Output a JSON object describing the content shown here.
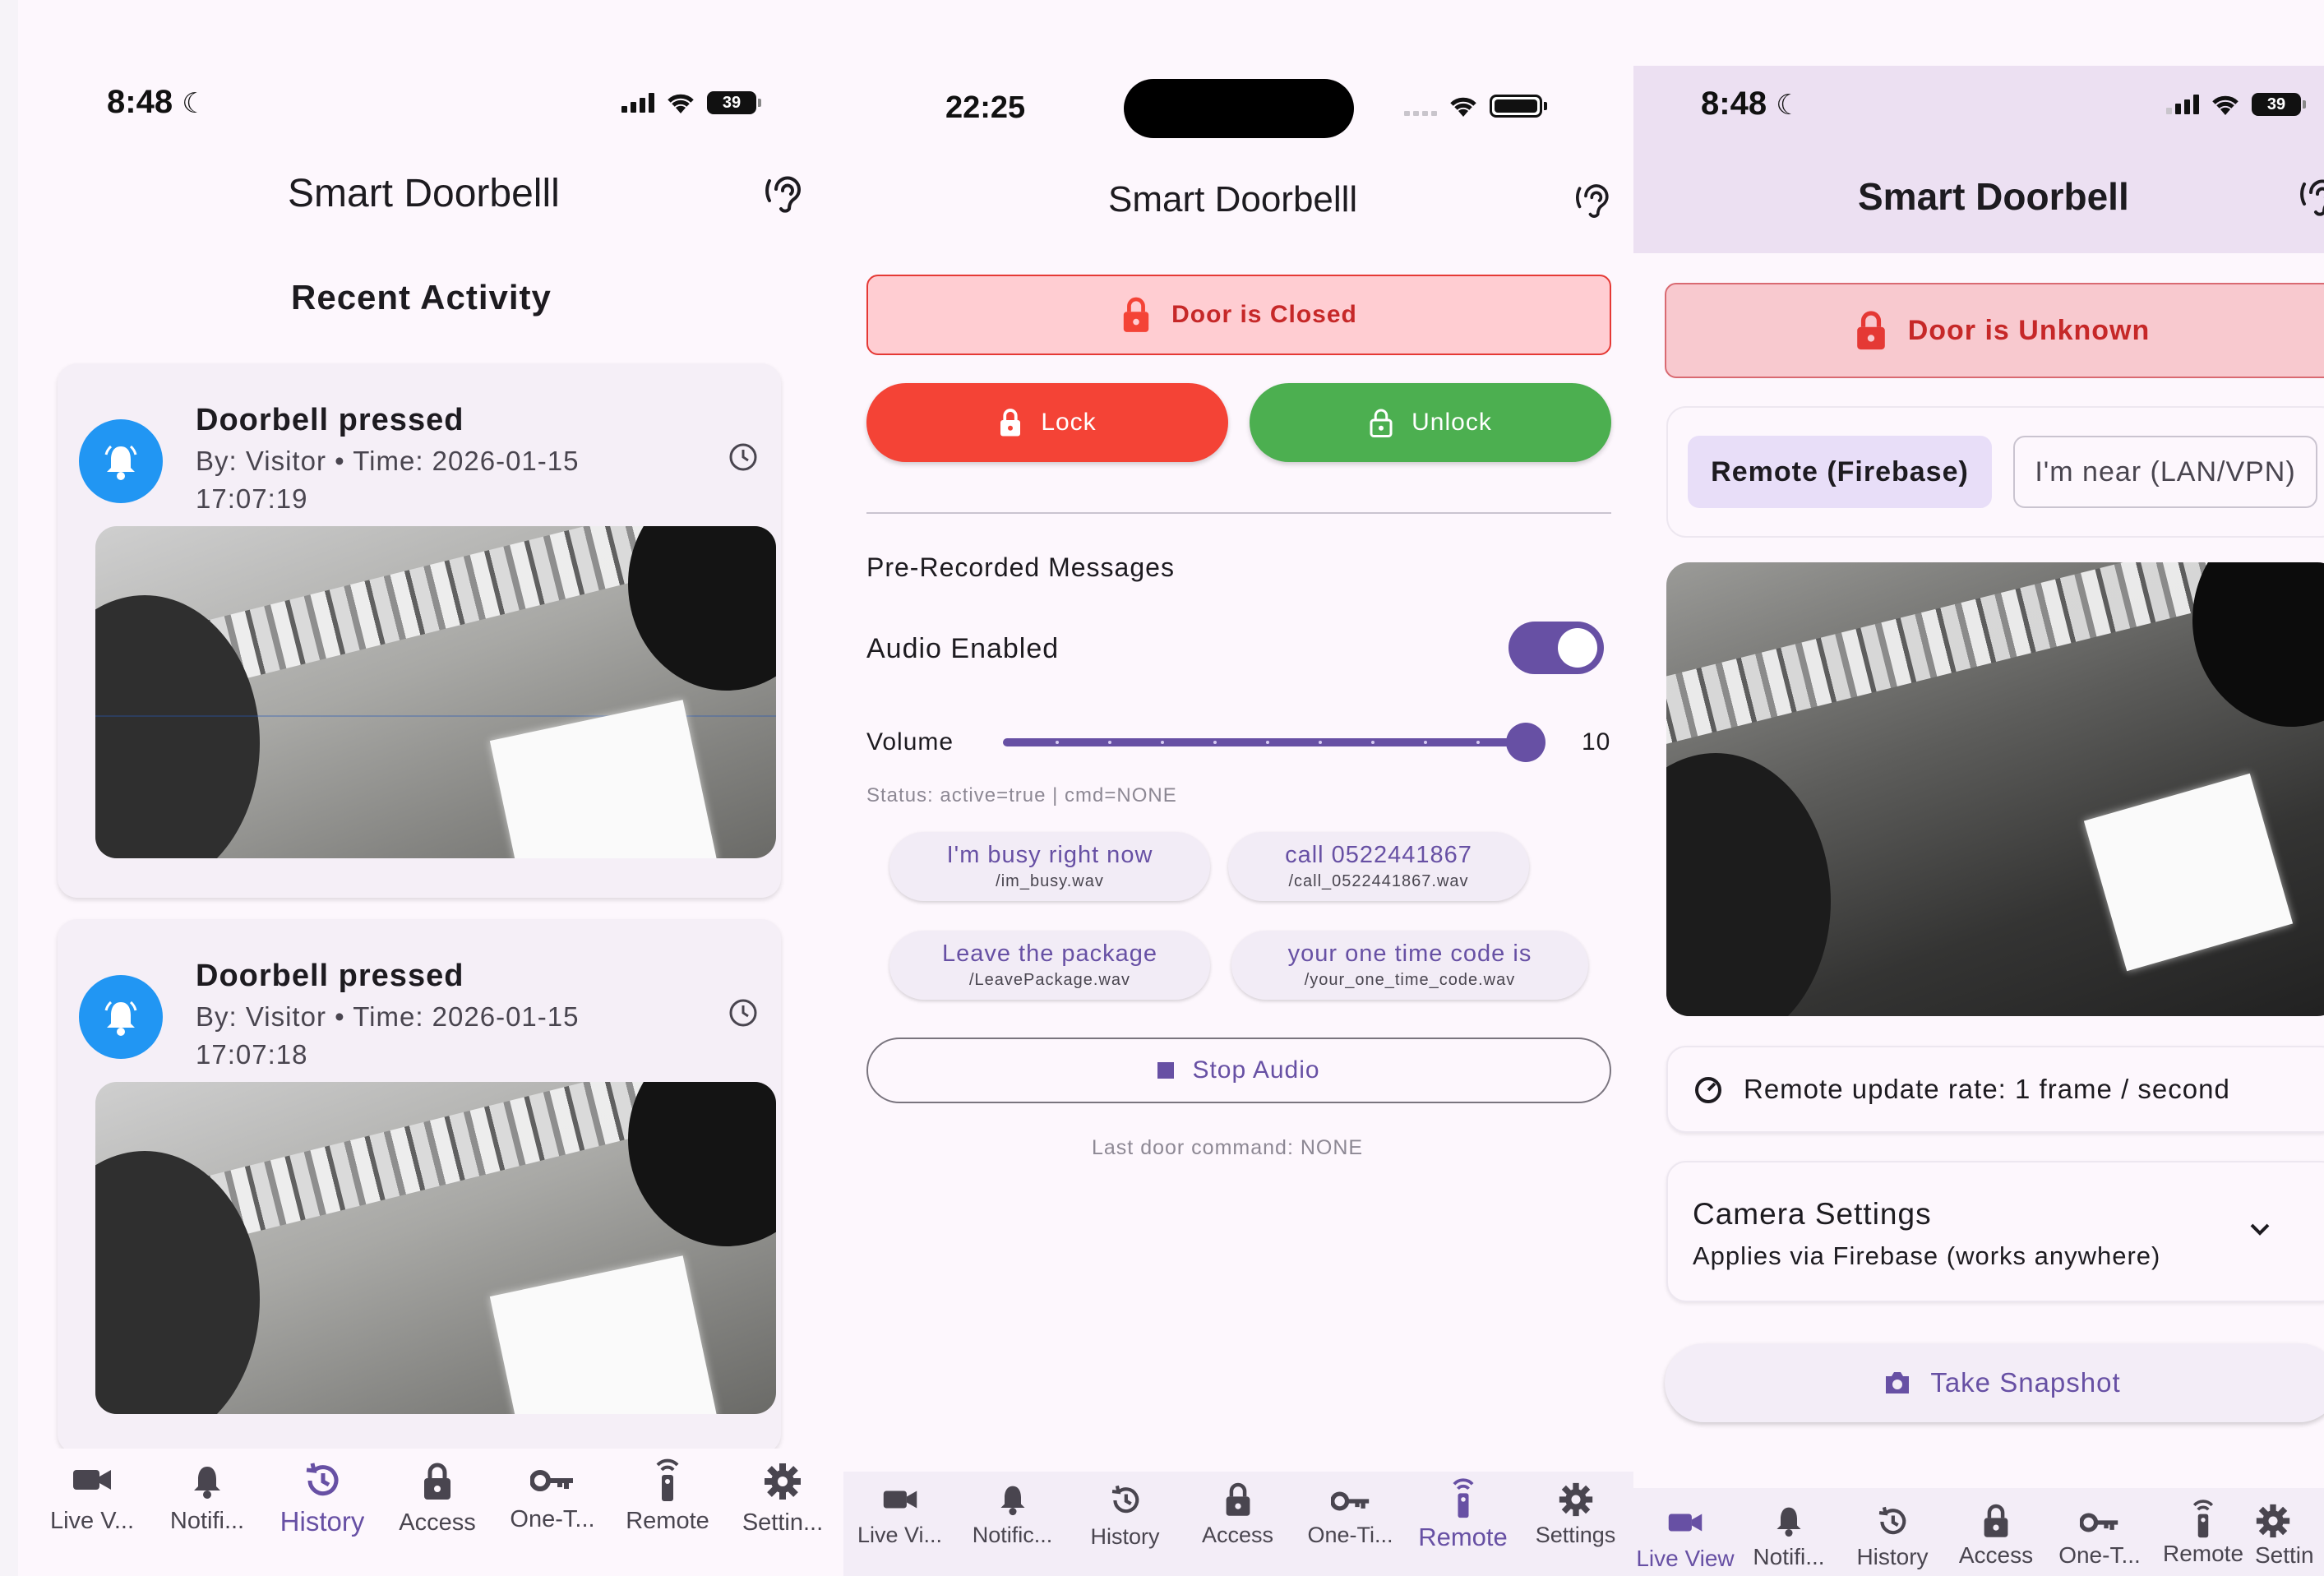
{
  "history_screen": {
    "status": {
      "time": "8:48",
      "battery": "39"
    },
    "app_title": "Smart Doorbelll",
    "section_title": "Recent Activity",
    "events": [
      {
        "title": "Doorbell pressed",
        "subtitle": "By: Visitor • Time: 2026-01-15 17:07:19"
      },
      {
        "title": "Doorbell pressed",
        "subtitle": "By: Visitor • Time: 2026-01-15 17:07:18"
      }
    ],
    "nav": [
      {
        "label": "Live V...",
        "icon": "videocam-icon"
      },
      {
        "label": "Notifi...",
        "icon": "bell-icon"
      },
      {
        "label": "History",
        "icon": "history-icon",
        "active": true
      },
      {
        "label": "Access",
        "icon": "lock-icon"
      },
      {
        "label": "One-T...",
        "icon": "key-icon"
      },
      {
        "label": "Remote",
        "icon": "remote-icon"
      },
      {
        "label": "Settin...",
        "icon": "gear-icon"
      }
    ]
  },
  "remote_screen": {
    "status": {
      "time": "22:25"
    },
    "app_title": "Smart Doorbelll",
    "door_status": "Door is Closed",
    "lock_label": "Lock",
    "unlock_label": "Unlock",
    "messages_title": "Pre-Recorded Messages",
    "audio_enabled_label": "Audio Enabled",
    "audio_enabled": true,
    "volume_label": "Volume",
    "volume_value": "10",
    "volume_fraction": 1.0,
    "status_text": "Status: active=true | cmd=NONE",
    "messages": [
      {
        "label": "I'm busy right now",
        "file": "/im_busy.wav"
      },
      {
        "label": "call 0522441867",
        "file": "/call_0522441867.wav"
      },
      {
        "label": "Leave the package",
        "file": "/LeavePackage.wav"
      },
      {
        "label": "your one time code is",
        "file": "/your_one_time_code.wav"
      }
    ],
    "stop_audio_label": "Stop Audio",
    "last_command": "Last door command: NONE",
    "nav": [
      {
        "label": "Live Vi...",
        "icon": "videocam-icon"
      },
      {
        "label": "Notific...",
        "icon": "bell-icon"
      },
      {
        "label": "History",
        "icon": "history-icon"
      },
      {
        "label": "Access",
        "icon": "lock-icon"
      },
      {
        "label": "One-Ti...",
        "icon": "key-icon"
      },
      {
        "label": "Remote",
        "icon": "remote-icon",
        "active": true
      },
      {
        "label": "Settings",
        "icon": "gear-icon"
      }
    ]
  },
  "live_screen": {
    "status": {
      "time": "8:48",
      "battery": "39"
    },
    "app_title": "Smart Doorbell",
    "door_status": "Door is Unknown",
    "mode_remote": "Remote (Firebase)",
    "mode_near": "I'm near (LAN/VPN)",
    "update_rate": "Remote update rate: 1 frame / second",
    "camera_settings_title": "Camera Settings",
    "camera_settings_subtitle": "Applies via Firebase (works anywhere)",
    "snapshot_label": "Take Snapshot",
    "nav": [
      {
        "label": "Live View",
        "icon": "videocam-icon",
        "active": true
      },
      {
        "label": "Notifi...",
        "icon": "bell-icon"
      },
      {
        "label": "History",
        "icon": "history-icon"
      },
      {
        "label": "Access",
        "icon": "lock-icon"
      },
      {
        "label": "One-T...",
        "icon": "key-icon"
      },
      {
        "label": "Remote",
        "icon": "remote-icon"
      },
      {
        "label": "Settin",
        "icon": "gear-icon"
      }
    ]
  },
  "colors": {
    "accent": "#6750a4",
    "danger": "#f44336",
    "success": "#4caf50",
    "bell": "#2196f3",
    "door_bg": "#ffcdd2"
  }
}
